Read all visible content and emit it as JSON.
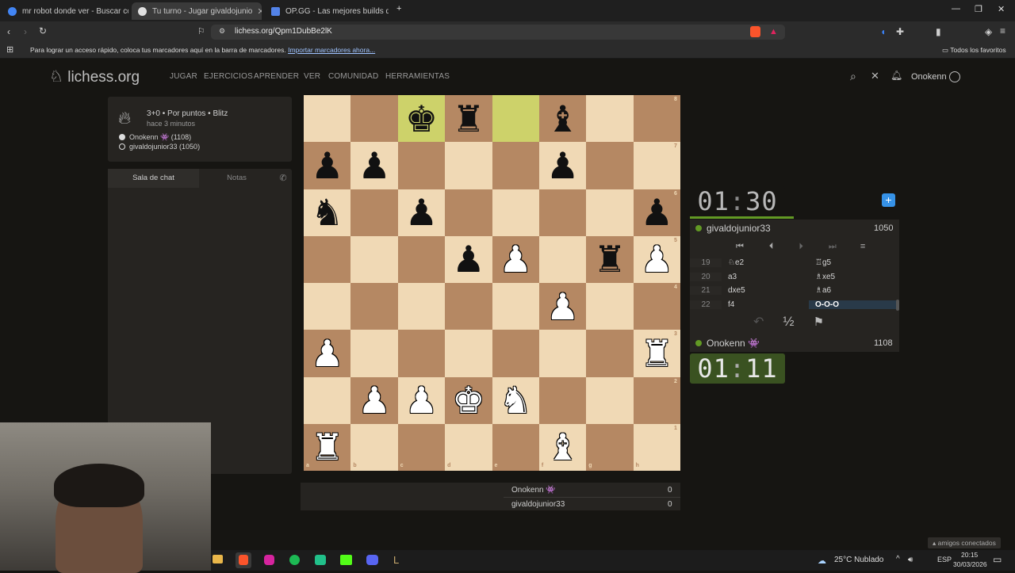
{
  "browser": {
    "tabs": [
      {
        "title": "mr robot donde ver - Buscar con Goo",
        "fav": "#4285f4"
      },
      {
        "title": "Tu turno - Jugar givaldojunio",
        "fav": "#e0e0e0",
        "active": true
      },
      {
        "title": "OP.GG - Las mejores builds de LoL y",
        "fav": "#5383e8"
      }
    ],
    "url": "lichess.org/Qpm1DubBe2lK",
    "bookmarks_text": "Para lograr un acceso rápido, coloca tus marcadores aquí en la barra de marcadores.",
    "bookmarks_link": "Importar marcadores ahora...",
    "favorites": "Todos los favoritos"
  },
  "site": {
    "logo": "lichess.org",
    "nav": [
      "JUGAR",
      "EJERCICIOS",
      "APRENDER",
      "VER",
      "COMUNIDAD",
      "HERRAMIENTAS"
    ],
    "user": "Onokenn"
  },
  "game": {
    "mode": "3+0 • Por puntos • Blitz",
    "ago": "hace 3 minutos",
    "white": "Onokenn 👾 (1108)",
    "black": "givaldojunior33 (1050)"
  },
  "chat": {
    "tab1": "Sala de chat",
    "tab2": "Notas"
  },
  "board": {
    "ranks": [
      "8",
      "7",
      "6",
      "5",
      "4",
      "3",
      "2",
      "1"
    ],
    "files": [
      "a",
      "b",
      "c",
      "d",
      "e",
      "f",
      "g",
      "h"
    ],
    "highlight": [
      "c8",
      "e8"
    ],
    "pieces": {
      "c8": "bK",
      "d8": "bR",
      "f8": "bB",
      "a7": "bP",
      "b7": "bP",
      "f7": "bP",
      "a6": "bN",
      "c6": "bP",
      "h6": "bP",
      "d5": "bP",
      "e5": "wP",
      "g5": "bR",
      "h5": "wP",
      "f4": "wP",
      "a3": "wP",
      "h3": "wR",
      "b2": "wP",
      "c2": "wP",
      "d2": "wK",
      "e2": "wN",
      "a1": "wR",
      "f1": "wB"
    }
  },
  "clocks": {
    "top": {
      "min": "01",
      "sec": "30"
    },
    "bottom": {
      "min": "01",
      "sec": "11"
    }
  },
  "players": {
    "top": {
      "name": "givaldojunior33",
      "rating": "1050"
    },
    "bottom": {
      "name": "Onokenn 👾",
      "rating": "1108"
    }
  },
  "moves": [
    {
      "n": "19",
      "w": "♘e2",
      "b": "♖g5"
    },
    {
      "n": "20",
      "w": "a3",
      "b": "♗xe5"
    },
    {
      "n": "21",
      "w": "dxe5",
      "b": "♗a6"
    },
    {
      "n": "22",
      "w": "f4",
      "b": "O-O-O",
      "selected": true
    }
  ],
  "controls": {
    "draw": "½"
  },
  "score": {
    "row1": {
      "name": "Onokenn 👾",
      "val": "0"
    },
    "row2": {
      "name": "givaldojunior33",
      "val": "0"
    }
  },
  "taskbar": {
    "weather": "25°C  Nublado",
    "lang": "ESP",
    "time": "20:15",
    "date": "30/03/2026",
    "friends": "▴ amigos conectados"
  }
}
